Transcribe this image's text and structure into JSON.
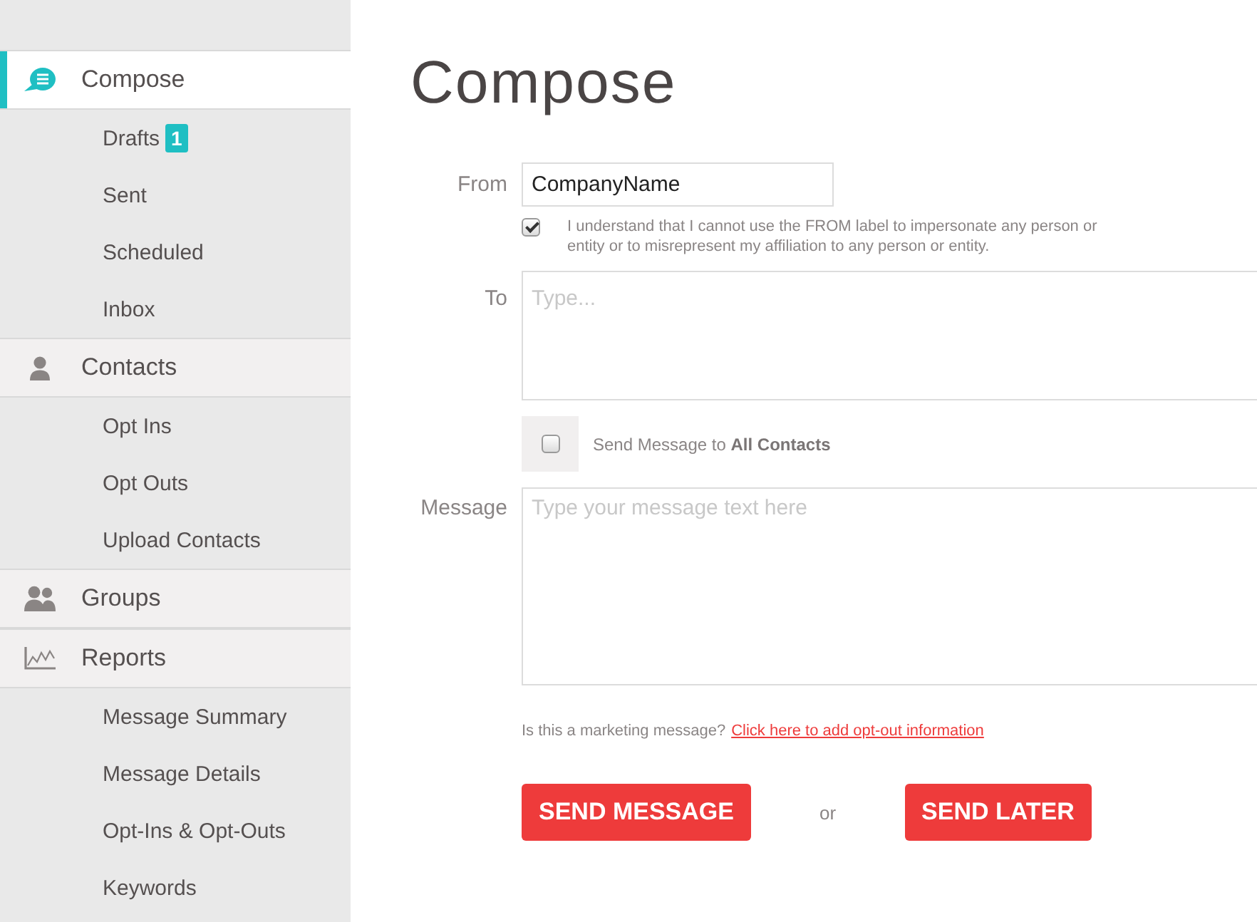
{
  "sidebar": {
    "sections": [
      {
        "label": "Compose",
        "selected": true,
        "children": [
          {
            "label": "Drafts",
            "badge": "1",
            "selected": false
          },
          {
            "label": "Sent",
            "selected": false
          },
          {
            "label": "Scheduled",
            "selected": false
          },
          {
            "label": "Inbox",
            "selected": false
          }
        ]
      },
      {
        "label": "Contacts",
        "selected": false,
        "children": [
          {
            "label": "Opt Ins",
            "selected": false
          },
          {
            "label": "Opt Outs",
            "selected": false
          },
          {
            "label": "Upload Contacts",
            "selected": false
          }
        ]
      },
      {
        "label": "Groups",
        "selected": false
      },
      {
        "label": "Reports",
        "selected": false,
        "children": [
          {
            "label": "Message Summary",
            "selected": false
          },
          {
            "label": "Message Details",
            "selected": false
          },
          {
            "label": "Opt-Ins & Opt-Outs",
            "selected": false
          },
          {
            "label": "Keywords",
            "selected": false
          }
        ]
      }
    ]
  },
  "page": {
    "title": "Compose"
  },
  "form": {
    "from": {
      "label": "From",
      "value": "CompanyName"
    },
    "consent": {
      "checked": true,
      "text": "I understand that I cannot use the FROM label to impersonate any person or entity or to misrepresent my affiliation to any person or entity."
    },
    "to": {
      "label": "To",
      "placeholder": "Type..."
    },
    "all_contacts": {
      "checked": false,
      "text": "Send Message to **All Contacts**"
    },
    "message": {
      "label": "Message",
      "placeholder": "Type your message text here"
    },
    "marketing_note": {
      "question": "Is this a marketing message?",
      "link": "Click here to add opt-out information"
    },
    "actions": {
      "primary": "SEND MESSAGE",
      "separator": "or",
      "secondary": "SEND LATER"
    }
  }
}
